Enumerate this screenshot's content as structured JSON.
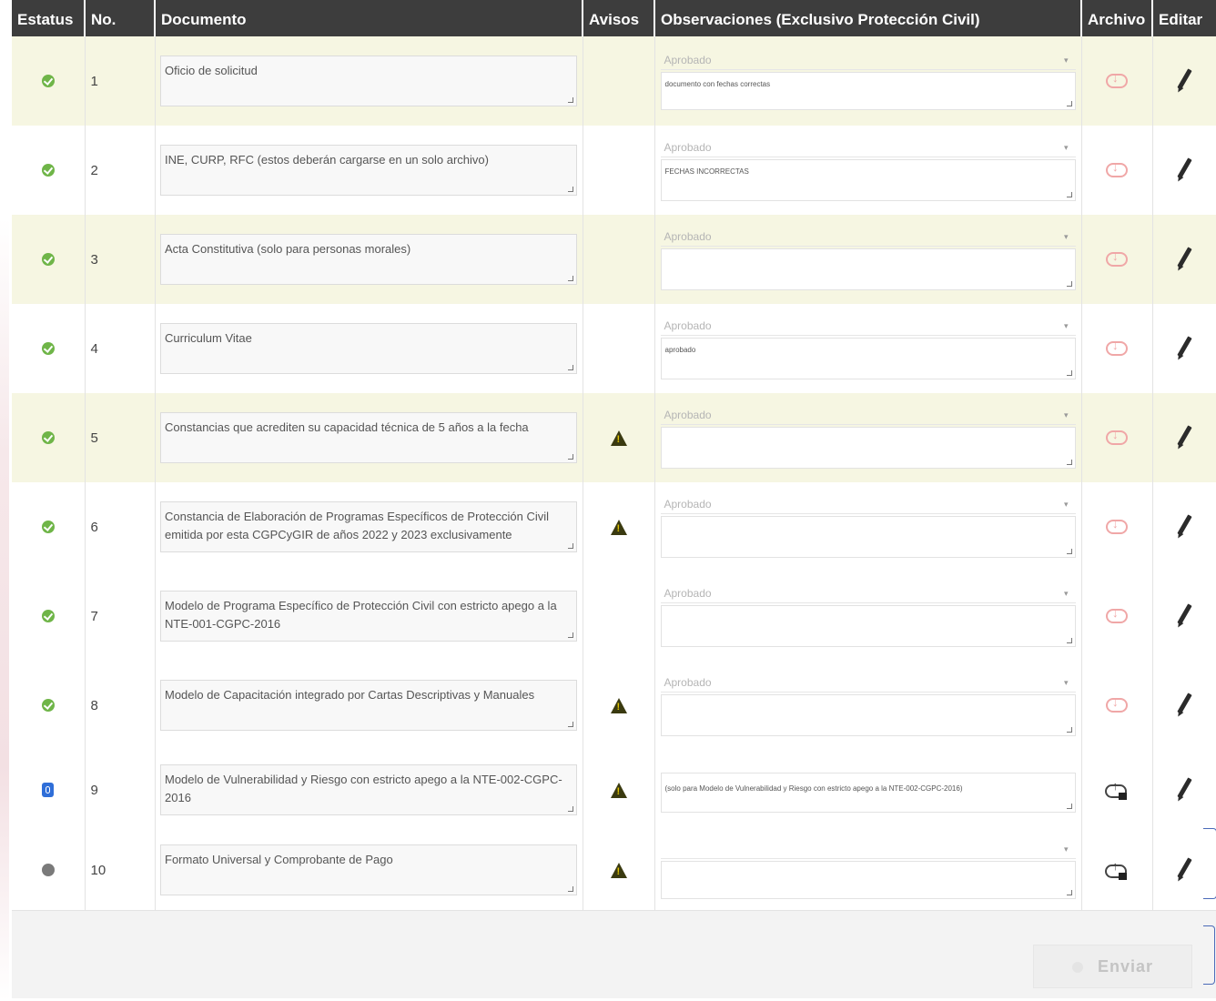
{
  "header": {
    "estatus": "Estatus",
    "no": "No.",
    "documento": "Documento",
    "avisos": "Avisos",
    "observaciones": "Observaciones (Exclusivo Protección Civil)",
    "archivo": "Archivo",
    "editar": "Editar"
  },
  "rows": [
    {
      "num": "1",
      "doc": "Oficio de solicitud",
      "select": "Aprobado",
      "obs": "documento con fechas correctas"
    },
    {
      "num": "2",
      "doc": "INE, CURP, RFC (estos deberán cargarse en un solo archivo)",
      "select": "Aprobado",
      "obs": "FECHAS INCORRECTAS"
    },
    {
      "num": "3",
      "doc": "Acta Constitutiva (solo para personas morales)",
      "select": "Aprobado",
      "obs": ""
    },
    {
      "num": "4",
      "doc": "Curriculum Vitae",
      "select": "Aprobado",
      "obs": "aprobado"
    },
    {
      "num": "5",
      "doc": "Constancias que acrediten su capacidad técnica de 5 años a la fecha",
      "select": "Aprobado",
      "obs": ""
    },
    {
      "num": "6",
      "doc": "Constancia de Elaboración de Programas Específicos de Protección Civil emitida por esta CGPCyGIR de años 2022 y 2023 exclusivamente",
      "select": "Aprobado",
      "obs": ""
    },
    {
      "num": "7",
      "doc": "Modelo de Programa Específico de Protección Civil con estricto apego a la NTE-001-CGPC-2016",
      "select": "Aprobado",
      "obs": ""
    },
    {
      "num": "8",
      "doc": "Modelo de Capacitación integrado por Cartas Descriptivas y Manuales",
      "select": "Aprobado",
      "obs": ""
    },
    {
      "num": "9",
      "doc": "Modelo de Vulnerabilidad y Riesgo con estricto apego a la NTE-002-CGPC-2016",
      "select": "",
      "obs": "(solo para Modelo de Vulnerabilidad y Riesgo con estricto apego a la NTE-002-CGPC-2016)"
    },
    {
      "num": "10",
      "doc": "Formato Universal y Comprobante de Pago",
      "select": "",
      "obs": ""
    }
  ],
  "footer": {
    "send_label": "Enviar"
  }
}
